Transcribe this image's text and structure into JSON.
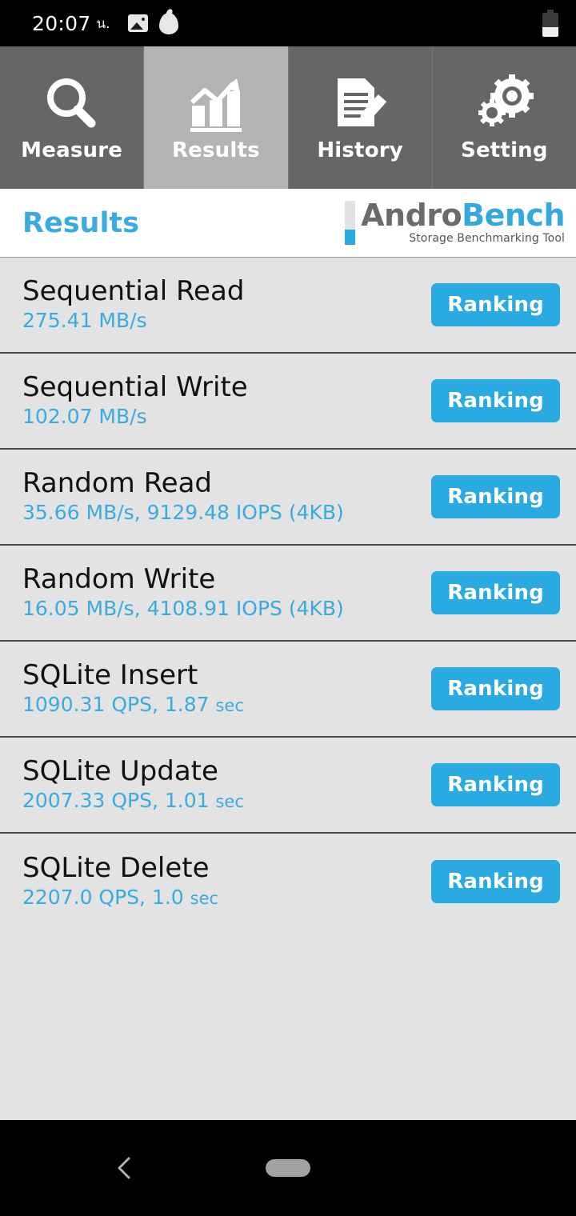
{
  "status_bar": {
    "time": "20:07",
    "time_unit": "น.",
    "icons": [
      "image-icon",
      "flame-icon"
    ],
    "battery": "battery-icon"
  },
  "tabs": [
    {
      "label": "Measure",
      "icon": "magnifier-icon",
      "active": false
    },
    {
      "label": "Results",
      "icon": "bar-chart-icon",
      "active": true
    },
    {
      "label": "History",
      "icon": "document-pencil-icon",
      "active": false
    },
    {
      "label": "Setting",
      "icon": "gears-icon",
      "active": false
    }
  ],
  "header": {
    "title": "Results",
    "logo": {
      "name_part1": "Andro",
      "name_part2": "Bench",
      "tagline": "Storage Benchmarking Tool"
    }
  },
  "results": [
    {
      "title": "Sequential Read",
      "value": "275.41 MB/s",
      "value_sec": "",
      "button": "Ranking"
    },
    {
      "title": "Sequential Write",
      "value": "102.07 MB/s",
      "value_sec": "",
      "button": "Ranking"
    },
    {
      "title": "Random Read",
      "value": "35.66 MB/s, 9129.48 IOPS (4KB)",
      "value_sec": "",
      "button": "Ranking"
    },
    {
      "title": "Random Write",
      "value": "16.05 MB/s, 4108.91 IOPS (4KB)",
      "value_sec": "",
      "button": "Ranking"
    },
    {
      "title": "SQLite Insert",
      "value": "1090.31 QPS, 1.87 ",
      "value_sec": "sec",
      "button": "Ranking"
    },
    {
      "title": "SQLite Update",
      "value": "2007.33 QPS, 1.01 ",
      "value_sec": "sec",
      "button": "Ranking"
    },
    {
      "title": "SQLite Delete",
      "value": "2207.0 QPS, 1.0 ",
      "value_sec": "sec",
      "button": "Ranking"
    }
  ],
  "nav_bar": {
    "back": "back-chevron-icon",
    "home": "home-pill-icon"
  },
  "colors": {
    "accent_blue": "#29abe2",
    "title_blue": "#3aabdf",
    "tab_inactive": "#666666",
    "tab_active": "#b3b3b3",
    "content_bg": "#e3e3e3",
    "divider": "#4b4b4b"
  }
}
